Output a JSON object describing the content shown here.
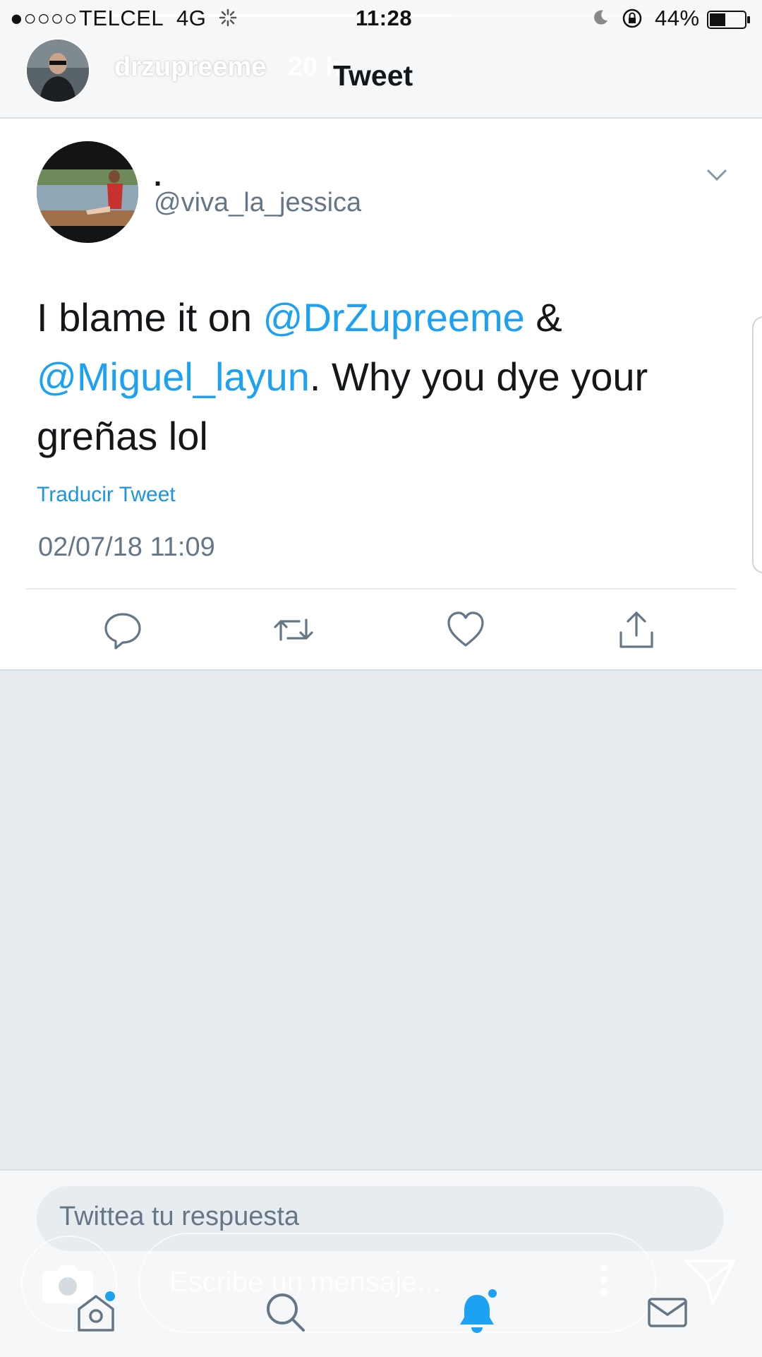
{
  "status_bar": {
    "signal": "●○○○○",
    "carrier": "TELCEL",
    "network": "4G",
    "time": "11:28",
    "battery_percent": "44%"
  },
  "story": {
    "username": "drzupreeme",
    "time_ago": "20 h",
    "progress": 0.55
  },
  "header": {
    "title": "Tweet"
  },
  "tweet": {
    "author_name": ".",
    "author_handle": "@viva_la_jessica",
    "text_1": "I blame it on ",
    "mention_1": "@DrZupreeme",
    "text_2": " & ",
    "mention_2": "@Miguel_layun",
    "text_3": ". Why you dye your greñas lol",
    "translate_label": "Traducir Tweet",
    "timestamp": "02/07/18 11:09"
  },
  "actions": {
    "icons": [
      "reply-icon",
      "retweet-icon",
      "like-icon",
      "share-icon"
    ]
  },
  "reply": {
    "placeholder": "Twittea tu respuesta"
  },
  "story_reply": {
    "placeholder": "Escribe un mensaje..."
  },
  "tab_bar": {
    "icons": [
      "home-icon",
      "search-icon",
      "notifications-icon",
      "messages-icon"
    ]
  },
  "colors": {
    "accent": "#1da1f2",
    "text": "#14171a",
    "secondary": "#657786",
    "background": "#e6ecf0"
  }
}
